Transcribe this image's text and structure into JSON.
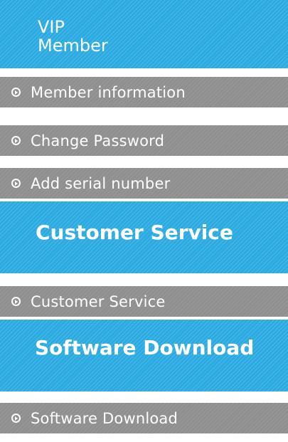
{
  "sections": [
    {
      "title_lines": [
        "VIP",
        "Member"
      ],
      "items": [
        {
          "label": "Member information",
          "icon": "circle-arrow-icon"
        },
        {
          "label": "Change Password",
          "icon": "circle-arrow-icon"
        },
        {
          "label": "Add serial number",
          "icon": "circle-arrow-icon"
        }
      ]
    },
    {
      "title_lines": [
        "Customer Service"
      ],
      "items": [
        {
          "label": "Customer Service",
          "icon": "circle-arrow-icon"
        }
      ]
    },
    {
      "title_lines": [
        "Software Download"
      ],
      "items": [
        {
          "label": "Software Download",
          "icon": "circle-arrow-icon"
        }
      ]
    }
  ],
  "colors": {
    "header_blue": "#29aae1",
    "item_gray": "#8f8f8f",
    "text": "#ffffff"
  }
}
